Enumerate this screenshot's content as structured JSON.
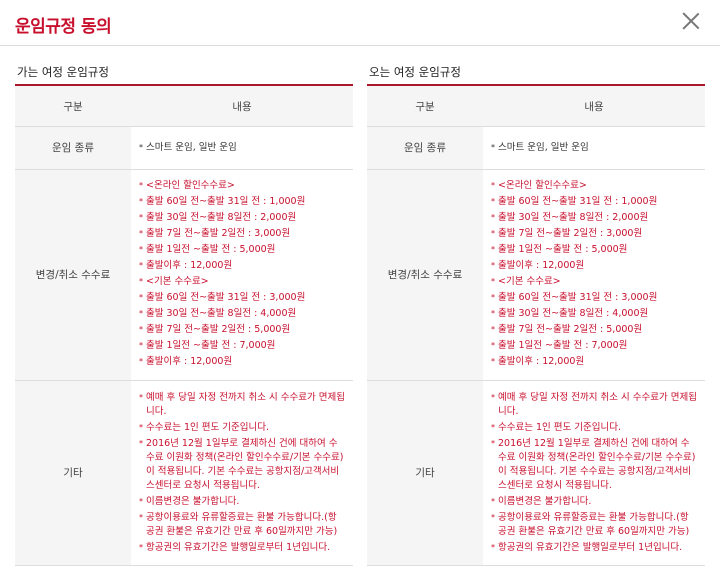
{
  "header": {
    "title": "운임규정 동의"
  },
  "table_header": {
    "col1": "구분",
    "col2": "내용"
  },
  "sections": [
    {
      "title": "가는 여정 운임규정",
      "fare_type_label": "운임 종류",
      "fare_type_value": "스마트 운임, 일반 운임",
      "fee_label": "변경/취소 수수료",
      "fees": [
        "<온라인 할인수수료>",
        "출발 60일 전~출발 31일 전 : 1,000원",
        "출발 30일 전~출발 8일전 : 2,000원",
        "출발 7일 전~출발 2일전 : 3,000원",
        "출발 1일전 ~출발 전 : 5,000원",
        "출발이후 : 12,000원",
        "<기본 수수료>",
        "출발 60일 전~출발 31일 전 : 3,000원",
        "출발 30일 전~출발 8일전 : 4,000원",
        "출발 7일 전~출발 2일전 : 5,000원",
        "출발 1일전 ~출발 전 : 7,000원",
        "출발이후 : 12,000원"
      ],
      "etc_label": "기타",
      "etc": [
        "예매 후 당일 자정 전까지 취소 시 수수료가 면제됩니다.",
        "수수료는 1인 편도 기준입니다.",
        "2016년 12월 1일부로 결제하신 건에 대하여 수수료 이원화 정책(온라인 할인수수료/기본 수수료)이 적용됩니다. 기본 수수료는 공항지점/고객서비스센터로 요청시 적용됩니다.",
        "이름변경은 불가합니다.",
        "공항이용료와 유류할증료는 환불 가능합니다.(항공권 환불은 유효기간 만료 후 60일까지만 가능)",
        "항공권의 유효기간은 발행일로부터 1년입니다."
      ]
    },
    {
      "title": "오는 여정 운임규정",
      "fare_type_label": "운임 종류",
      "fare_type_value": "스마트 운임, 일반 운임",
      "fee_label": "변경/취소 수수료",
      "fees": [
        "<온라인 할인수수료>",
        "출발 60일 전~출발 31일 전 : 1,000원",
        "출발 30일 전~출발 8일전 : 2,000원",
        "출발 7일 전~출발 2일전 : 3,000원",
        "출발 1일전 ~출발 전 : 5,000원",
        "출발이후 : 12,000원",
        "<기본 수수료>",
        "출발 60일 전~출발 31일 전 : 3,000원",
        "출발 30일 전~출발 8일전 : 4,000원",
        "출발 7일 전~출발 2일전 : 5,000원",
        "출발 1일전 ~출발 전 : 7,000원",
        "출발이후 : 12,000원"
      ],
      "etc_label": "기타",
      "etc": [
        "예매 후 당일 자정 전까지 취소 시 수수료가 면제됩니다.",
        "수수료는 1인 편도 기준입니다.",
        "2016년 12월 1일부로 결제하신 건에 대하여 수수료 이원화 정책(온라인 할인수수료/기본 수수료)이 적용됩니다. 기본 수수료는 공항지점/고객서비스센터로 요청시 적용됩니다.",
        "이름변경은 불가합니다.",
        "공항이용료와 유류할증료는 환불 가능합니다.(항공권 환불은 유효기간 만료 후 60일까지만 가능)",
        "항공권의 유효기간은 발행일로부터 1년입니다."
      ]
    }
  ],
  "colors": {
    "accent": "#c8102e",
    "header_bg": "#f5f5f5"
  }
}
